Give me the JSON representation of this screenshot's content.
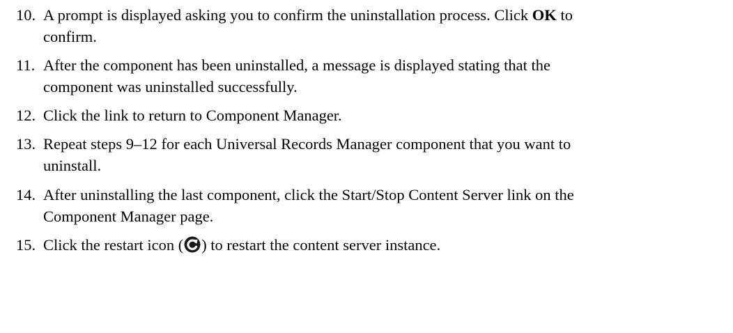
{
  "steps": [
    {
      "number": "10.",
      "lines": [
        {
          "before": "A prompt is displayed asking you to confirm the uninstallation process. Click ",
          "bold": "OK",
          "after": " to"
        },
        {
          "text": "confirm."
        }
      ]
    },
    {
      "number": "11.",
      "lines": [
        {
          "text": "After the component has been uninstalled, a message is displayed stating that the"
        },
        {
          "text": "component was uninstalled successfully."
        }
      ]
    },
    {
      "number": "12.",
      "lines": [
        {
          "text": "Click the link to return to Component Manager."
        }
      ]
    },
    {
      "number": "13.",
      "lines": [
        {
          "text": "Repeat steps 9–12 for each Universal Records Manager component that you want to"
        },
        {
          "text": "uninstall."
        }
      ]
    },
    {
      "number": "14.",
      "lines": [
        {
          "text": "After uninstalling the last component, click the Start/Stop Content Server link on the"
        },
        {
          "text": "Component Manager page."
        }
      ]
    },
    {
      "number": "15.",
      "lines": [
        {
          "before": "Click the restart icon (",
          "icon": "restart-icon",
          "after": ") to restart the content server instance."
        }
      ]
    }
  ]
}
